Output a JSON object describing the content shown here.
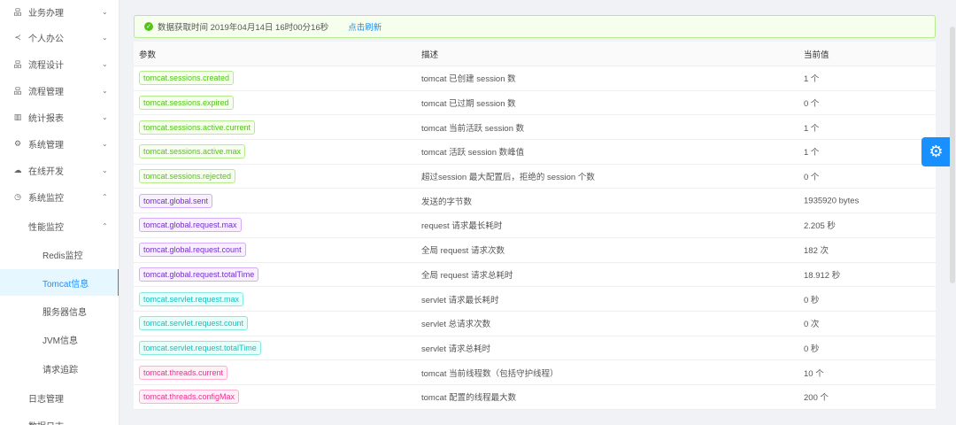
{
  "sidebar": {
    "items": [
      {
        "label": "业务办理",
        "icon": "apps-icon",
        "chevron": "⌄"
      },
      {
        "label": "个人办公",
        "icon": "share-icon",
        "chevron": "⌄"
      },
      {
        "label": "流程设计",
        "icon": "apps-icon",
        "chevron": "⌄"
      },
      {
        "label": "流程管理",
        "icon": "apps-icon",
        "chevron": "⌄"
      },
      {
        "label": "统计报表",
        "icon": "bar-chart-icon",
        "chevron": "⌄"
      },
      {
        "label": "系统管理",
        "icon": "gear-icon",
        "chevron": "⌄"
      },
      {
        "label": "在线开发",
        "icon": "cloud-icon",
        "chevron": "⌄"
      },
      {
        "label": "系统监控",
        "icon": "dashboard-icon",
        "chevron": "⌃"
      }
    ],
    "sub": {
      "label": "性能监控",
      "chevron": "⌃"
    },
    "subitems": [
      "Redis监控",
      "Tomcat信息",
      "服务器信息",
      "JVM信息",
      "请求追踪"
    ],
    "after": [
      "日志管理",
      "数据日志"
    ]
  },
  "alert": {
    "text": "数据获取时间 2019年04月14日 16时00分16秒",
    "refresh": "点击刷新"
  },
  "table": {
    "headers": [
      "参数",
      "描述",
      "当前值"
    ],
    "rows": [
      {
        "param": "tomcat.sessions.created",
        "color": "green",
        "desc": "tomcat 已创建 session 数",
        "value": "1 个"
      },
      {
        "param": "tomcat.sessions.expired",
        "color": "green",
        "desc": "tomcat 已过期 session 数",
        "value": "0 个"
      },
      {
        "param": "tomcat.sessions.active.current",
        "color": "green",
        "desc": "tomcat 当前活跃 session 数",
        "value": "1 个"
      },
      {
        "param": "tomcat.sessions.active.max",
        "color": "green",
        "desc": "tomcat 活跃 session 数峰值",
        "value": "1 个"
      },
      {
        "param": "tomcat.sessions.rejected",
        "color": "green",
        "desc": "超过session 最大配置后，拒绝的 session 个数",
        "value": "0 个"
      },
      {
        "param": "tomcat.global.sent",
        "color": "purple",
        "desc": "发送的字节数",
        "value": "1935920 bytes"
      },
      {
        "param": "tomcat.global.request.max",
        "color": "purple",
        "desc": "request 请求最长耗时",
        "value": "2.205 秒"
      },
      {
        "param": "tomcat.global.request.count",
        "color": "purple",
        "desc": "全局 request 请求次数",
        "value": "182 次"
      },
      {
        "param": "tomcat.global.request.totalTime",
        "color": "purple",
        "desc": "全局 request 请求总耗时",
        "value": "18.912 秒"
      },
      {
        "param": "tomcat.servlet.request.max",
        "color": "cyan",
        "desc": "servlet 请求最长耗时",
        "value": "0 秒"
      },
      {
        "param": "tomcat.servlet.request.count",
        "color": "cyan",
        "desc": "servlet 总请求次数",
        "value": "0 次"
      },
      {
        "param": "tomcat.servlet.request.totalTime",
        "color": "cyan",
        "desc": "servlet 请求总耗时",
        "value": "0 秒"
      },
      {
        "param": "tomcat.threads.current",
        "color": "magenta",
        "desc": "tomcat 当前线程数（包括守护线程）",
        "value": "10 个"
      },
      {
        "param": "tomcat.threads.configMax",
        "color": "magenta",
        "desc": "tomcat 配置的线程最大数",
        "value": "200 个"
      }
    ]
  }
}
